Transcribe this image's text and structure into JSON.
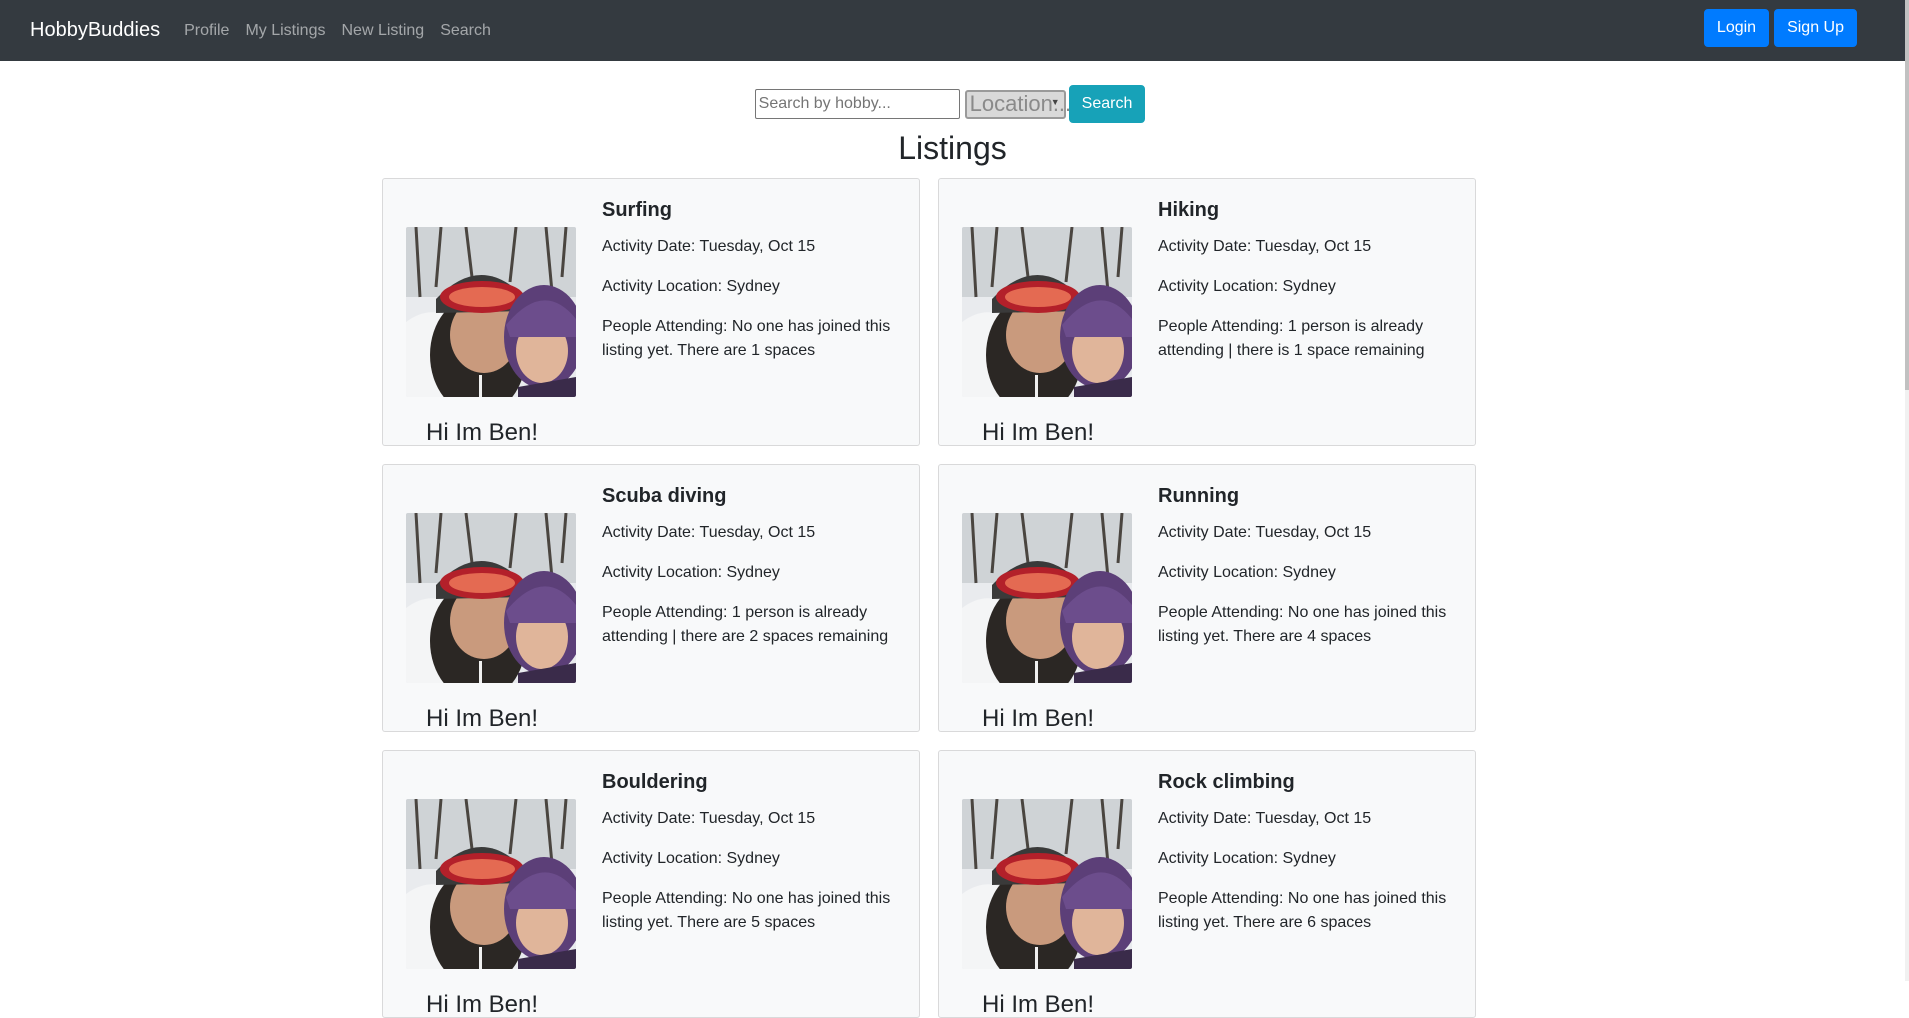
{
  "nav": {
    "brand": "HobbyBuddies",
    "links": [
      "Profile",
      "My Listings",
      "New Listing",
      "Search"
    ],
    "login": "Login",
    "signup": "Sign Up"
  },
  "search": {
    "placeholder": "Search by hobby...",
    "location_value": "Location...",
    "button": "Search"
  },
  "page_title": "Listings",
  "labels": {
    "date": "Activity Date: ",
    "location": "Activity Location: ",
    "people": "People Attending: "
  },
  "listings": [
    {
      "title": "Surfing",
      "date": "Tuesday, Oct 15",
      "location": "Sydney",
      "people": "No one has joined this listing yet. There are 1 spaces",
      "greeting": "Hi Im Ben!"
    },
    {
      "title": "Hiking",
      "date": "Tuesday, Oct 15",
      "location": "Sydney",
      "people": "1 person is already attending | there is 1 space remaining",
      "greeting": "Hi Im Ben!"
    },
    {
      "title": "Scuba diving",
      "date": "Tuesday, Oct 15",
      "location": "Sydney",
      "people": "1 person is already attending | there are 2 spaces remaining",
      "greeting": "Hi Im Ben!"
    },
    {
      "title": "Running",
      "date": "Tuesday, Oct 15",
      "location": "Sydney",
      "people": "No one has joined this listing yet. There are 4 spaces",
      "greeting": "Hi Im Ben!"
    },
    {
      "title": "Bouldering",
      "date": "Tuesday, Oct 15",
      "location": "Sydney",
      "people": "No one has joined this listing yet. There are 5 spaces",
      "greeting": "Hi Im Ben!"
    },
    {
      "title": "Rock climbing",
      "date": "Tuesday, Oct 15",
      "location": "Sydney",
      "people": "No one has joined this listing yet. There are 6 spaces",
      "greeting": "Hi Im Ben!"
    }
  ],
  "colors": {
    "navbar": "#343a40",
    "primary": "#007bff",
    "info": "#17a2b8",
    "card_bg": "#f8f9fa"
  }
}
